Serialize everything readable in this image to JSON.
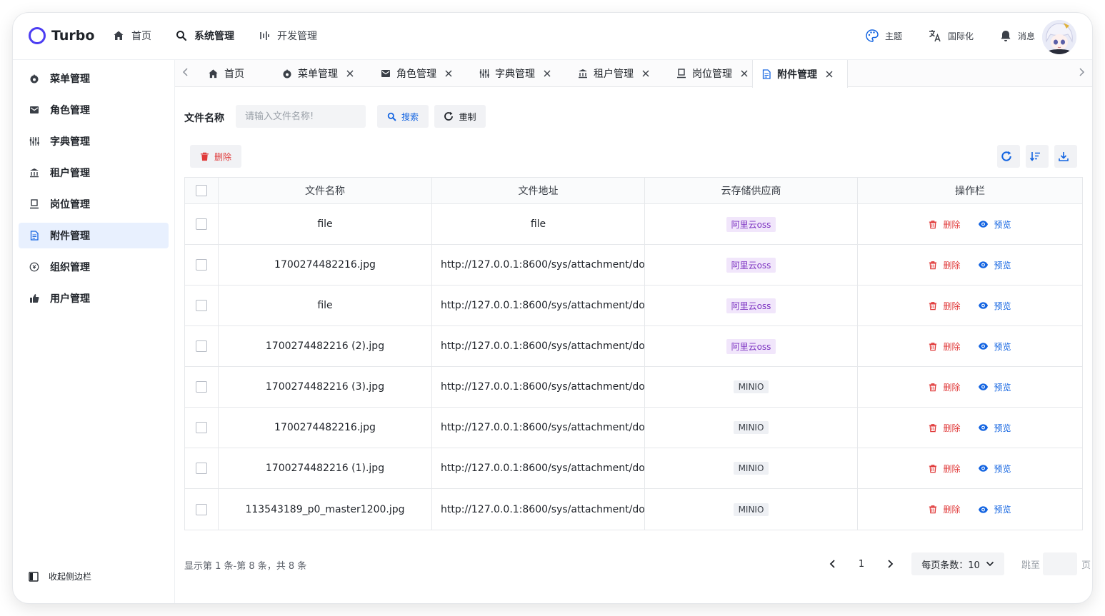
{
  "app": {
    "name": "Turbo"
  },
  "topnav": [
    {
      "label": "首页",
      "icon": "home-icon"
    },
    {
      "label": "系统管理",
      "icon": "search-icon",
      "active": true
    },
    {
      "label": "开发管理",
      "icon": "code-icon"
    }
  ],
  "topright": {
    "theme": "主题",
    "i18n": "国际化",
    "messages": "消息"
  },
  "sidebar": {
    "items": [
      {
        "label": "菜单管理",
        "icon": "fire-icon"
      },
      {
        "label": "角色管理",
        "icon": "mail-icon"
      },
      {
        "label": "字典管理",
        "icon": "sliders-icon"
      },
      {
        "label": "租户管理",
        "icon": "bank-icon"
      },
      {
        "label": "岗位管理",
        "icon": "post-icon"
      },
      {
        "label": "附件管理",
        "icon": "file-icon",
        "active": true
      },
      {
        "label": "组织管理",
        "icon": "org-icon"
      },
      {
        "label": "用户管理",
        "icon": "thumb-icon"
      }
    ],
    "collapse_label": "收起侧边栏"
  },
  "tabs": [
    {
      "label": "首页",
      "icon": "home-icon",
      "closable": false
    },
    {
      "label": "菜单管理",
      "icon": "fire-icon",
      "closable": true
    },
    {
      "label": "角色管理",
      "icon": "mail-icon",
      "closable": true
    },
    {
      "label": "字典管理",
      "icon": "sliders-icon",
      "closable": true
    },
    {
      "label": "租户管理",
      "icon": "bank-icon",
      "closable": true
    },
    {
      "label": "岗位管理",
      "icon": "post-icon",
      "closable": true
    },
    {
      "label": "附件管理",
      "icon": "file-icon",
      "closable": true,
      "active": true
    }
  ],
  "search": {
    "label": "文件名称",
    "placeholder": "请输入文件名称!",
    "search_btn": "搜索",
    "reset_btn": "重制"
  },
  "toolbar": {
    "delete_btn": "删除"
  },
  "table": {
    "columns": [
      "文件名称",
      "文件地址",
      "云存储供应商",
      "操作栏"
    ],
    "rows": [
      {
        "name": "file",
        "url": "file",
        "provider": "阿里云oss"
      },
      {
        "name": "1700274482216.jpg",
        "url": "http://127.0.0.1:8600/sys/attachment/do...",
        "provider": "阿里云oss"
      },
      {
        "name": "file",
        "url": "http://127.0.0.1:8600/sys/attachment/do...",
        "provider": "阿里云oss"
      },
      {
        "name": "1700274482216 (2).jpg",
        "url": "http://127.0.0.1:8600/sys/attachment/do...",
        "provider": "阿里云oss"
      },
      {
        "name": "1700274482216 (3).jpg",
        "url": "http://127.0.0.1:8600/sys/attachment/do...",
        "provider": "MINIO"
      },
      {
        "name": "1700274482216.jpg",
        "url": "http://127.0.0.1:8600/sys/attachment/do...",
        "provider": "MINIO"
      },
      {
        "name": "1700274482216 (1).jpg",
        "url": "http://127.0.0.1:8600/sys/attachment/do...",
        "provider": "MINIO"
      },
      {
        "name": "113543189_p0_master1200.jpg",
        "url": "http://127.0.0.1:8600/sys/attachment/do...",
        "provider": "MINIO"
      }
    ],
    "actions": {
      "delete": "删除",
      "preview": "预览"
    }
  },
  "pagination": {
    "summary": "显示第 1 条-第 8 条，共 8 条",
    "current_page": "1",
    "page_size_label": "每页条数：10",
    "jump_label": "跳至",
    "page_suffix": "页"
  },
  "colors": {
    "accent": "#1364e1",
    "danger": "#e03a3a",
    "brand": "#4c3df2",
    "active_bg": "#e8f0fe"
  }
}
